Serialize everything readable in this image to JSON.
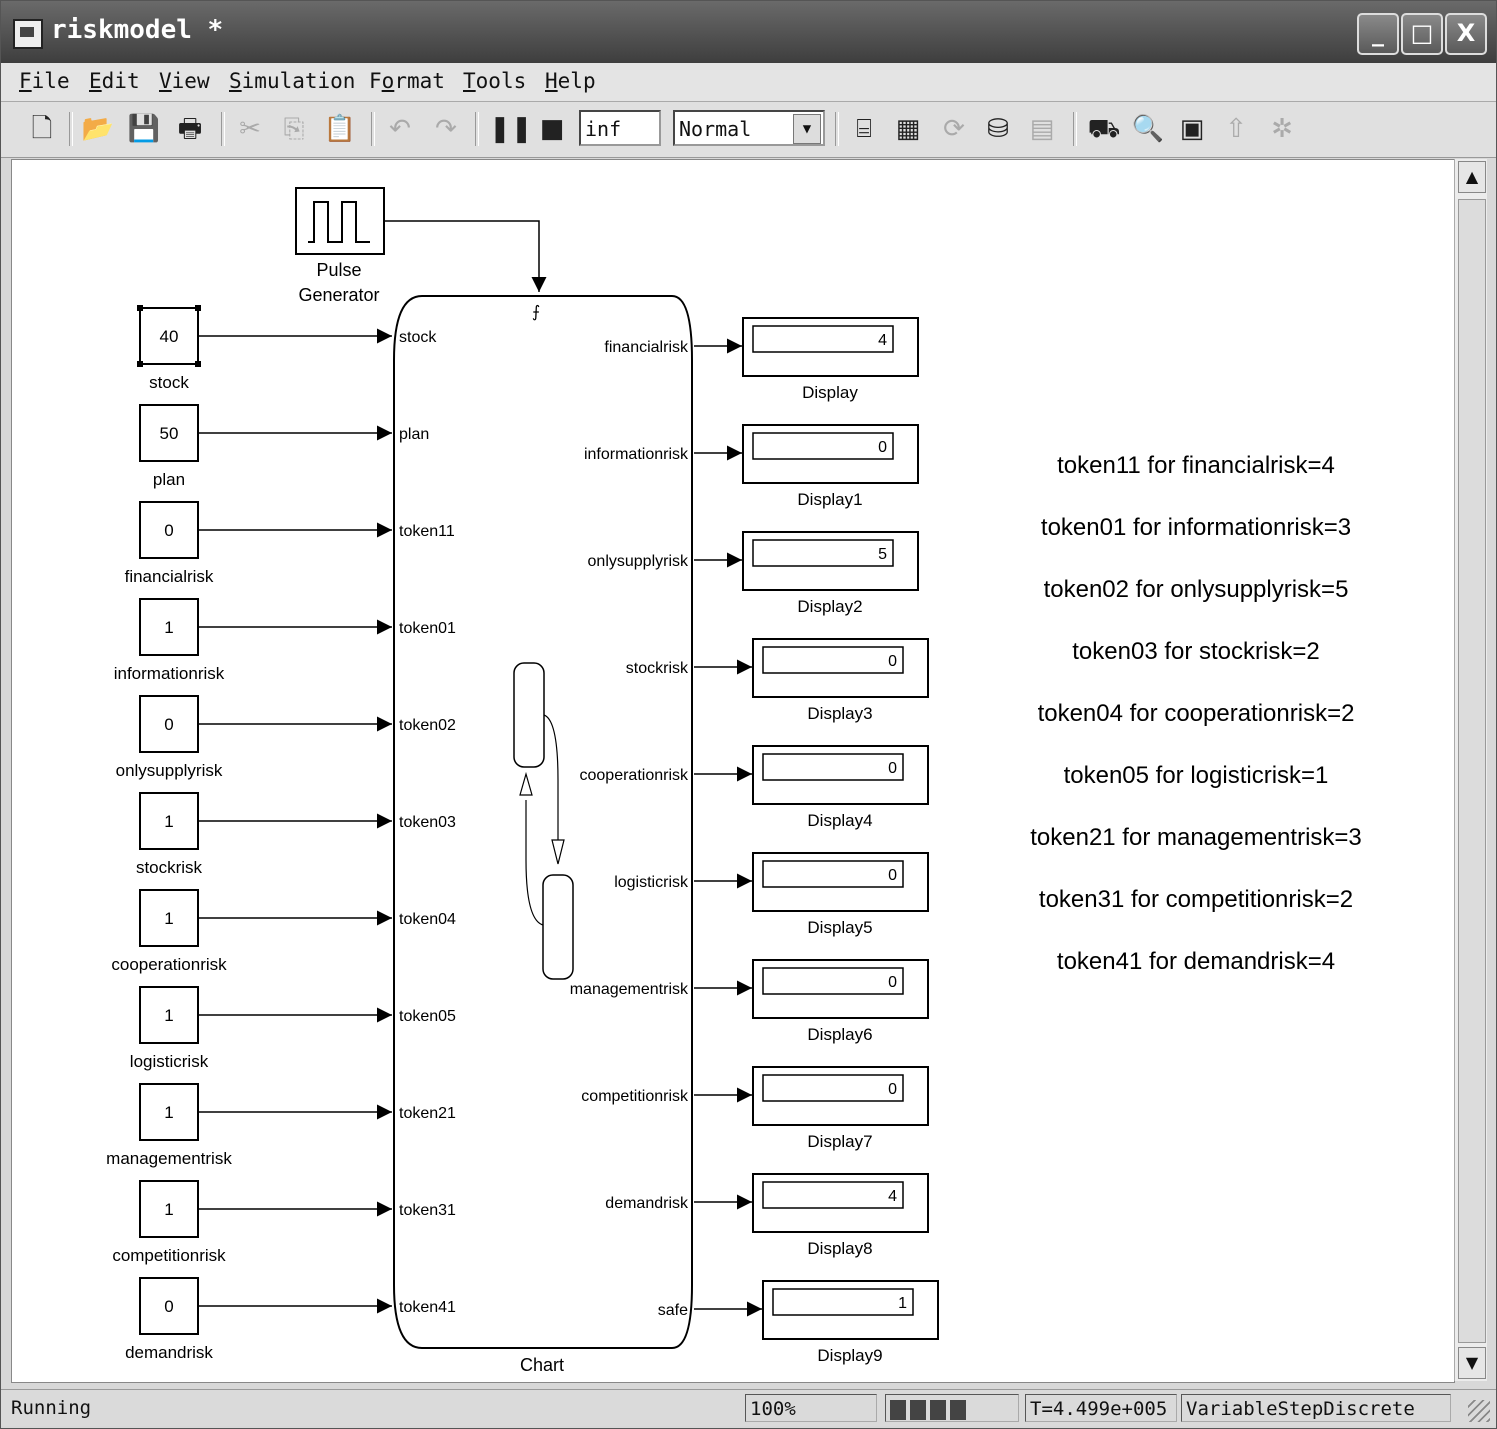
{
  "window": {
    "title": "riskmodel *"
  },
  "window_controls": {
    "minimize": "_",
    "maximize": "□",
    "close": "X"
  },
  "menu": [
    {
      "key": "F",
      "rest": "ile"
    },
    {
      "key": "E",
      "rest": "dit"
    },
    {
      "key": "V",
      "rest": "iew"
    },
    {
      "key": "S",
      "rest": "imulation"
    },
    {
      "key": "o",
      "pre": "F",
      "rest": "rmat"
    },
    {
      "key": "T",
      "rest": "ools"
    },
    {
      "key": "H",
      "rest": "elp"
    }
  ],
  "toolbar": {
    "stop_time": "inf",
    "sim_mode": "Normal",
    "icons": [
      "new-file-icon",
      "open-folder-icon",
      "save-icon",
      "print-icon",
      "cut-icon",
      "copy-icon",
      "paste-icon",
      "undo-icon",
      "redo-icon",
      "pause-icon",
      "stop-icon",
      "build-icon",
      "update-icon",
      "refresh-icon",
      "debug-icon",
      "library-icon",
      "model-explorer-icon",
      "find-icon",
      "go-to-parent-icon",
      "settings-icon"
    ]
  },
  "diagram": {
    "pulse_generator": {
      "label_line1": "Pulse",
      "label_line2": "Generator"
    },
    "chart": {
      "label": "Chart",
      "inputs": [
        "stock",
        "plan",
        "token11",
        "token01",
        "token02",
        "token03",
        "token04",
        "token05",
        "token21",
        "token31",
        "token41"
      ],
      "outputs": [
        "financialrisk",
        "informationrisk",
        "onlysupplyrisk",
        "stockrisk",
        "cooperationrisk",
        "logisticrisk",
        "managementrisk",
        "competitionrisk",
        "demandrisk",
        "safe"
      ]
    },
    "constants": [
      {
        "value": "40",
        "label": "stock"
      },
      {
        "value": "50",
        "label": "plan"
      },
      {
        "value": "0",
        "label": "financialrisk"
      },
      {
        "value": "1",
        "label": "informationrisk"
      },
      {
        "value": "0",
        "label": "onlysupplyrisk"
      },
      {
        "value": "1",
        "label": "stockrisk"
      },
      {
        "value": "1",
        "label": "cooperationrisk"
      },
      {
        "value": "1",
        "label": "logisticrisk"
      },
      {
        "value": "1",
        "label": "managementrisk"
      },
      {
        "value": "1",
        "label": "competitionrisk"
      },
      {
        "value": "0",
        "label": "demandrisk"
      }
    ],
    "displays": [
      {
        "value": "4",
        "label": "Display"
      },
      {
        "value": "0",
        "label": "Display1"
      },
      {
        "value": "5",
        "label": "Display2"
      },
      {
        "value": "0",
        "label": "Display3"
      },
      {
        "value": "0",
        "label": "Display4"
      },
      {
        "value": "0",
        "label": "Display5"
      },
      {
        "value": "0",
        "label": "Display6"
      },
      {
        "value": "0",
        "label": "Display7"
      },
      {
        "value": "4",
        "label": "Display8"
      },
      {
        "value": "1",
        "label": "Display9"
      }
    ],
    "annotations": [
      "token11 for financialrisk=4",
      "token01 for informationrisk=3",
      "token02 for onlysupplyrisk=5",
      "token03 for stockrisk=2",
      "token04 for cooperationrisk=2",
      "token05 for logisticrisk=1",
      "token21 for managementrisk=3",
      "token31 for competitionrisk=2",
      "token41 for demandrisk=4"
    ]
  },
  "status": {
    "state": "Running",
    "zoom": "100%",
    "time": "T=4.499e+005",
    "solver": "VariableStepDiscrete"
  }
}
